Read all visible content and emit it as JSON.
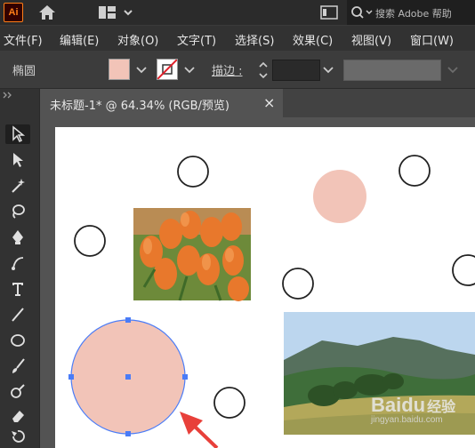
{
  "app": {
    "logo": "Ai"
  },
  "appbar": {
    "search_label": "搜索 Adobe 帮助",
    "icons": [
      "home-icon",
      "workspace-switcher-icon",
      "panel-icon",
      "search-icon"
    ]
  },
  "menubar": {
    "items": [
      {
        "label": "文件(F)"
      },
      {
        "label": "编辑(E)"
      },
      {
        "label": "对象(O)"
      },
      {
        "label": "文字(T)"
      },
      {
        "label": "选择(S)"
      },
      {
        "label": "效果(C)"
      },
      {
        "label": "视图(V)"
      },
      {
        "label": "窗口(W)"
      }
    ]
  },
  "controlbar": {
    "selection_type": "椭圆",
    "fill_color": "#f2c4b8",
    "stroke_label": "描边 :",
    "stroke_value": ""
  },
  "tab": {
    "title": "未标题-1* @ 64.34% (RGB/预览)",
    "close": "×"
  },
  "colors": {
    "accent_selection": "#4a7cf7",
    "circle_fill": "#f2c4b8",
    "arrow": "#e8403a"
  },
  "watermark": {
    "brand": "Baidu",
    "brand_cn": "经验",
    "url": "jingyan.baidu.com"
  }
}
